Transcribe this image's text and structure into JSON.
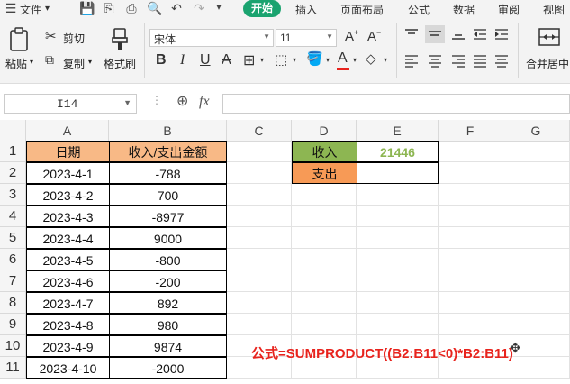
{
  "menu": {
    "file_label": "文件",
    "tabs": [
      "开始",
      "插入",
      "页面布局",
      "公式",
      "数据",
      "审阅",
      "视图"
    ],
    "active_tab": "开始"
  },
  "ribbon": {
    "paste_label": "粘贴",
    "cut_label": "剪切",
    "copy_label": "复制",
    "format_painter_label": "格式刷",
    "font_name": "宋体",
    "font_size": "11",
    "merge_center_label": "合并居中"
  },
  "formula_bar": {
    "cell_ref": "I14",
    "fx_label": "fx",
    "value": ""
  },
  "sheet": {
    "columns": [
      "A",
      "B",
      "C",
      "D",
      "E",
      "F",
      "G"
    ],
    "rows": [
      "1",
      "2",
      "3",
      "4",
      "5",
      "6",
      "7",
      "8",
      "9",
      "10",
      "11"
    ],
    "col_a": [
      "日期",
      "2023-4-1",
      "2023-4-2",
      "2023-4-3",
      "2023-4-4",
      "2023-4-5",
      "2023-4-6",
      "2023-4-7",
      "2023-4-8",
      "2023-4-9",
      "2023-4-10"
    ],
    "col_b": [
      "收入/支出金额",
      "-788",
      "700",
      "-8977",
      "9000",
      "-800",
      "-200",
      "892",
      "980",
      "9874",
      "-2000"
    ],
    "summary": {
      "income_label": "收入",
      "income_value": "21446",
      "expense_label": "支出",
      "expense_value": ""
    },
    "colors": {
      "header_fill": "#f8b986",
      "income_fill": "#8db652",
      "expense_fill": "#f79a56",
      "income_value_color": "#8db652"
    }
  },
  "annotation": "公式=SUMPRODUCT((B2:B11<0)*B2:B11)"
}
